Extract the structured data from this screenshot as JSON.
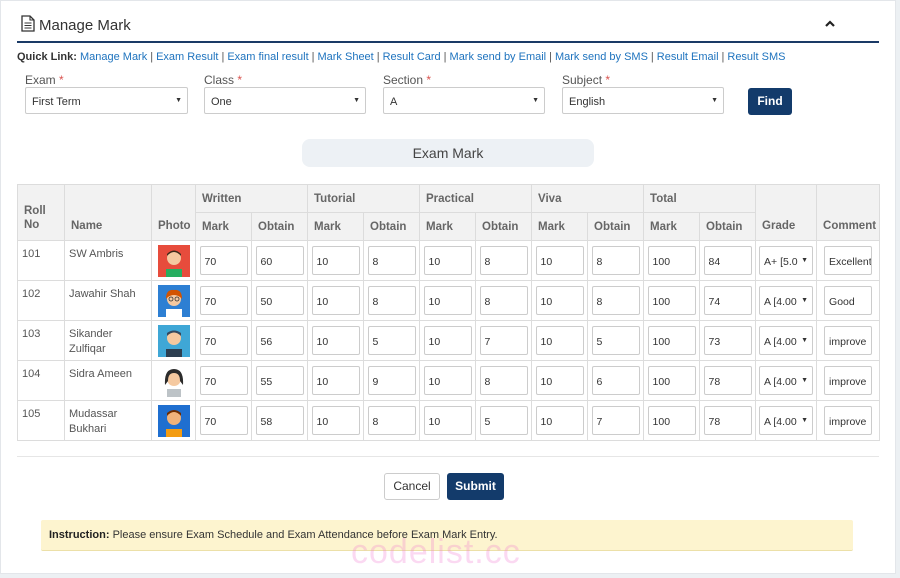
{
  "header": {
    "title": "Manage Mark"
  },
  "quick_links": {
    "label": "Quick Link:",
    "items": [
      "Manage Mark",
      "Exam Result",
      "Exam final result",
      "Mark Sheet",
      "Result Card",
      "Mark send by Email",
      "Mark send by SMS",
      "Result Email",
      "Result SMS"
    ],
    "separator": "|"
  },
  "filters": {
    "exam": {
      "label": "Exam",
      "value": "First Term"
    },
    "class": {
      "label": "Class",
      "value": "One"
    },
    "section": {
      "label": "Section",
      "value": "A"
    },
    "subject": {
      "label": "Subject",
      "value": "English"
    },
    "required_mark": "*",
    "find_label": "Find"
  },
  "section_title": "Exam Mark",
  "table": {
    "headers": {
      "roll": "Roll No",
      "name": "Name",
      "photo": "Photo",
      "written": "Written",
      "tutorial": "Tutorial",
      "practical": "Practical",
      "viva": "Viva",
      "total": "Total",
      "mark": "Mark",
      "obtain": "Obtain",
      "grade": "Grade",
      "comment": "Comment"
    },
    "rows": [
      {
        "roll": "101",
        "name": "SW Ambris",
        "written_mark": "70",
        "written_obtain": "60",
        "tutorial_mark": "10",
        "tutorial_obtain": "8",
        "practical_mark": "10",
        "practical_obtain": "8",
        "viva_mark": "10",
        "viva_obtain": "8",
        "total_mark": "100",
        "total_obtain": "84",
        "grade": "A+ [5.0",
        "comment": "Excellent"
      },
      {
        "roll": "102",
        "name": "Jawahir Shah",
        "written_mark": "70",
        "written_obtain": "50",
        "tutorial_mark": "10",
        "tutorial_obtain": "8",
        "practical_mark": "10",
        "practical_obtain": "8",
        "viva_mark": "10",
        "viva_obtain": "8",
        "total_mark": "100",
        "total_obtain": "74",
        "grade": "A [4.00",
        "comment": "Good"
      },
      {
        "roll": "103",
        "name": "Sikander Zulfiqar",
        "written_mark": "70",
        "written_obtain": "56",
        "tutorial_mark": "10",
        "tutorial_obtain": "5",
        "practical_mark": "10",
        "practical_obtain": "7",
        "viva_mark": "10",
        "viva_obtain": "5",
        "total_mark": "100",
        "total_obtain": "73",
        "grade": "A [4.00",
        "comment": "improve"
      },
      {
        "roll": "104",
        "name": "Sidra Ameen",
        "written_mark": "70",
        "written_obtain": "55",
        "tutorial_mark": "10",
        "tutorial_obtain": "9",
        "practical_mark": "10",
        "practical_obtain": "8",
        "viva_mark": "10",
        "viva_obtain": "6",
        "total_mark": "100",
        "total_obtain": "78",
        "grade": "A [4.00",
        "comment": "improve"
      },
      {
        "roll": "105",
        "name": "Mudassar Bukhari",
        "written_mark": "70",
        "written_obtain": "58",
        "tutorial_mark": "10",
        "tutorial_obtain": "8",
        "practical_mark": "10",
        "practical_obtain": "5",
        "viva_mark": "10",
        "viva_obtain": "7",
        "total_mark": "100",
        "total_obtain": "78",
        "grade": "A [4.00",
        "comment": "improve"
      }
    ]
  },
  "actions": {
    "cancel": "Cancel",
    "submit": "Submit"
  },
  "instruction": {
    "label": "Instruction:",
    "text": "Please ensure Exam Schedule and Exam Attendance before Exam Mark Entry."
  },
  "watermark": "codelist.cc",
  "colors": {
    "primary": "#133b6b",
    "link": "#1e73be",
    "required": "#d9534f",
    "instruction_bg": "#fdf4cf"
  },
  "icons": {
    "header": "document-icon",
    "collapse": "chevron-up-icon",
    "select": "caret-down-icon"
  }
}
